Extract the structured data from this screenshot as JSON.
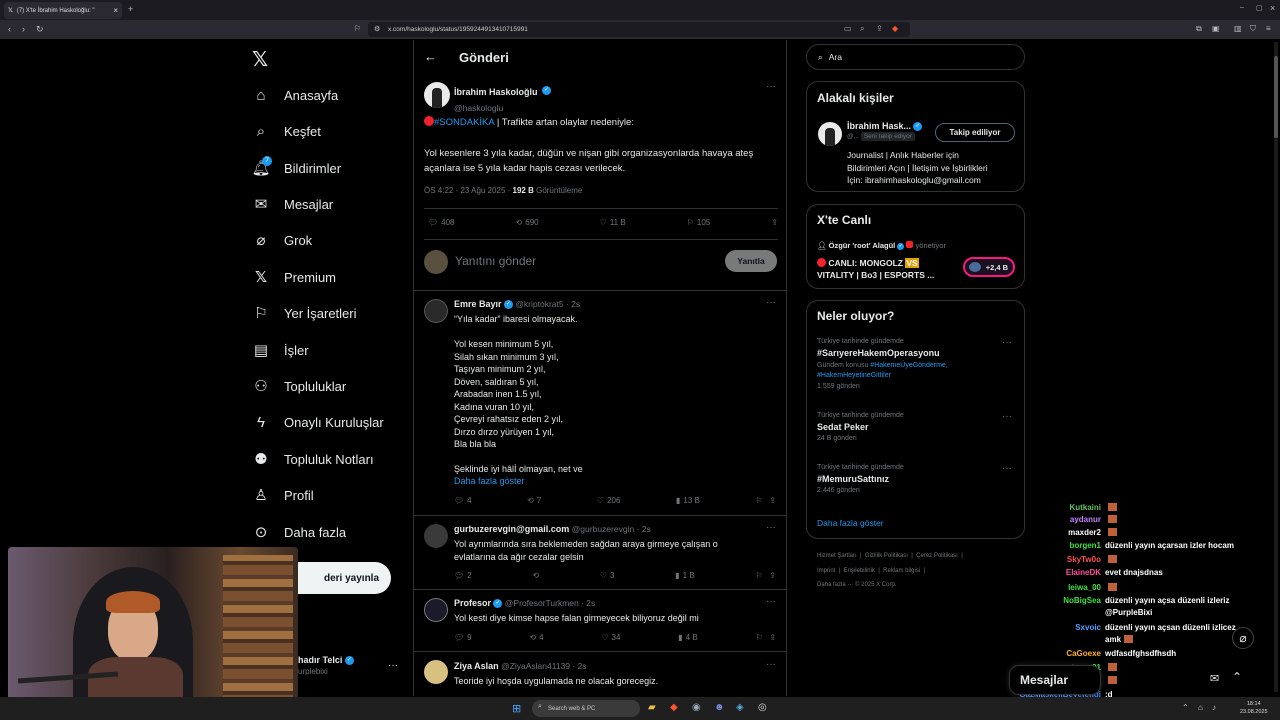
{
  "browser": {
    "tab_title": "(7) X'te İbrahim Haskoloğlu: \"",
    "url": "x.com/haskologlu/status/1959244913410715991"
  },
  "nav": {
    "items": [
      {
        "label": "Anasayfa",
        "icon": "home-icon"
      },
      {
        "label": "Keşfet",
        "icon": "search-icon"
      },
      {
        "label": "Bildirimler",
        "icon": "bell-icon",
        "badge": "7"
      },
      {
        "label": "Mesajlar",
        "icon": "mail-icon"
      },
      {
        "label": "Grok",
        "icon": "grok-icon"
      },
      {
        "label": "Premium",
        "icon": "x-logo-icon"
      },
      {
        "label": "Yer İşaretleri",
        "icon": "bookmark-icon"
      },
      {
        "label": "İşler",
        "icon": "briefcase-icon"
      },
      {
        "label": "Topluluklar",
        "icon": "people-icon"
      },
      {
        "label": "Onaylı Kuruluşlar",
        "icon": "lightning-icon"
      },
      {
        "label": "Topluluk Notları",
        "icon": "community-notes-icon"
      },
      {
        "label": "Profil",
        "icon": "person-icon"
      },
      {
        "label": "Daha fazla",
        "icon": "more-circle-icon"
      }
    ],
    "post_button": "deri yayınla",
    "account_name": "hadır Telci",
    "account_handle": "urplebixi"
  },
  "header": {
    "title": "Gönderi"
  },
  "tweet": {
    "author": "İbrahim Haskoloğlu",
    "handle": "@haskologlu",
    "hashtag": "#SONDAKİKA",
    "headline_rest": " | Trafikte artan olaylar nedeniyle:",
    "body": "Yol kesenlere 3 yıla kadar, düğün ve nişan gibi organizasyonlarda havaya ateş açanlara ise 5 yıla kadar hapis cezası verilecek.",
    "time": "ÖS 4:22 · 23 Ağu 2025 · ",
    "views": "192 B",
    "views_label": " Görüntüleme",
    "replies": "408",
    "reposts": "690",
    "likes": "11 B",
    "bookmarks": "105"
  },
  "compose": {
    "placeholder": "Yanıtını gönder",
    "button": "Yanıtla"
  },
  "replies": [
    {
      "author": "Emre Bayır",
      "handle": "@kriptokrat5 · 2s",
      "lines": [
        "“Yıla kadar” ibaresi olmayacak.",
        "",
        "Yol kesen minimum 5 yıl,",
        "Silah sıkan minimum 3 yıl,",
        "Taşıyan minimum 2 yıl,",
        "Döven, saldıran 5 yıl,",
        "Arabadan inen 1.5 yıl,",
        "Kadına vuran 10 yıl,",
        "Çevreyi rahatsız eden 2 yıl,",
        "Dırzo dırzo yürüyen 1 yıl,",
        "Bla bla bla",
        "",
        "Şeklinde iyi hâlİ olmayan, net ve"
      ],
      "more": "Daha fazla göster",
      "stats": [
        "4",
        "7",
        "206",
        "13 B"
      ]
    },
    {
      "author": "gurbuzerevgin@gmail.com",
      "handle": "@gurbuzerevgin · 2s",
      "lines": [
        "Yol ayrımlarında sıra beklemeden sağdan araya girmeye çalışan o",
        "evlatlarına da ağır cezalar gelsin"
      ],
      "stats": [
        "2",
        "",
        "3",
        "1 B"
      ]
    },
    {
      "author": "Profesor",
      "handle": "@ProfesorTurkmen · 2s",
      "lines": [
        "Yol kesti diye kimse hapse falan girmeyecek biliyoruz değil mi"
      ],
      "stats": [
        "9",
        "4",
        "34",
        "4 B"
      ]
    },
    {
      "author": "Ziya Aslan",
      "handle": "@ZiyaAslan41139 · 2s",
      "lines": [
        "Teoride iyi hoşda uygulamada ne olacak gorecegiz."
      ],
      "stats": []
    }
  ],
  "search": {
    "placeholder": "Ara"
  },
  "related": {
    "title": "Alakalı kişiler",
    "name": "İbrahim Hask...",
    "handle": "@...",
    "follows_you": "Seni takip ediyor",
    "follow_button": "Takip ediliyor",
    "bio": [
      "Journalist | Anlık Haberler için",
      "Bildirimleri Açın | İletişim ve İşbirlikleri",
      "İçin: ibrahimhaskologlu@gmail.com"
    ]
  },
  "live": {
    "title": "X'te Canlı",
    "host": "Özgür 'root' Alagül",
    "host_role": "yönetiyor",
    "event_line1": "CANLI: MONGOLZ ",
    "vs": "VS",
    "event_line2": "VITALITY | Bo3 | ESPORTS ...",
    "count": "+2,4 B"
  },
  "trends": {
    "title": "Neler oluyor?",
    "items": [
      {
        "category": "Türkiye tarihinde gündemde",
        "name": "#SarıyereHakemOperasyonu",
        "extra": "Gündem konusu ",
        "extra_tags": [
          "#HakemeÜyeGönderme,",
          "#HakemHeyetineGittiler"
        ],
        "count": "1.559 gönderi"
      },
      {
        "category": "Türkiye tarihinde gündemde",
        "name": "Sedat Peker",
        "count": "24 B gönderi"
      },
      {
        "category": "Türkiye tarihinde gündemde",
        "name": "#MemuruSattınız",
        "count": "2.446 gönderi"
      }
    ],
    "more": "Daha fazla göster"
  },
  "footer": {
    "line1": [
      "Hizmet Şartları",
      "Gizlilik Politikası",
      "Çerez Politikası"
    ],
    "line2": [
      "Imprint",
      "Erişilebilirlik",
      "Reklam bilgisi"
    ],
    "line3": "Daha fazla ···   © 2025 X Corp."
  },
  "chat": [
    {
      "user": "Kutkaini",
      "msg": "",
      "color": "#5fbf5f"
    },
    {
      "user": "aydanur",
      "msg": "",
      "color": "#c080ff"
    },
    {
      "user": "maxder2",
      "msg": "",
      "color": "#ffffff"
    },
    {
      "user": "borgen1",
      "msg": "düzenli yayın açarsan izler hocam",
      "color": "#40e040"
    },
    {
      "user": "SkyTw0o",
      "msg": "",
      "color": "#ff5050"
    },
    {
      "user": "ElaineDK",
      "msg": "evet dnajsdnas",
      "color": "#ff4fa0"
    },
    {
      "user": "leiwa_00",
      "msg": "",
      "color": "#40e040"
    },
    {
      "user": "NoBigSea",
      "msg": "düzenli yayın açsa düzenli izleriz",
      "color": "#40e040"
    },
    {
      "user": "",
      "msg": "@PurpleBixi",
      "color": "#ffffff"
    },
    {
      "user": "Sxvoic",
      "msg": "düzenli yayın açsan düzenli izlicez",
      "color": "#50a0ff"
    },
    {
      "user": "",
      "msg": "amk",
      "color": "#ffffff"
    },
    {
      "user": "CaGoexe",
      "msg": "wdfasdfghsdfhsdh",
      "color": "#ffb030"
    },
    {
      "user": "vortex_x01",
      "msg": "",
      "color": "#40e040"
    },
    {
      "user": "Psaqor",
      "msg": "",
      "color": "#40e040"
    },
    {
      "user": "GazMaskeliBeyefendi",
      "msg": ":d",
      "color": "#4080ff"
    }
  ],
  "messages_drawer": {
    "label": "Mesajlar"
  },
  "taskbar": {
    "search": "Search web & PC",
    "time": "18:14",
    "date": "23.08.2025"
  },
  "colors": {
    "accent": "#1d9bf0",
    "background": "#000000",
    "border": "#2f3336",
    "live_red": "#f4212e"
  }
}
